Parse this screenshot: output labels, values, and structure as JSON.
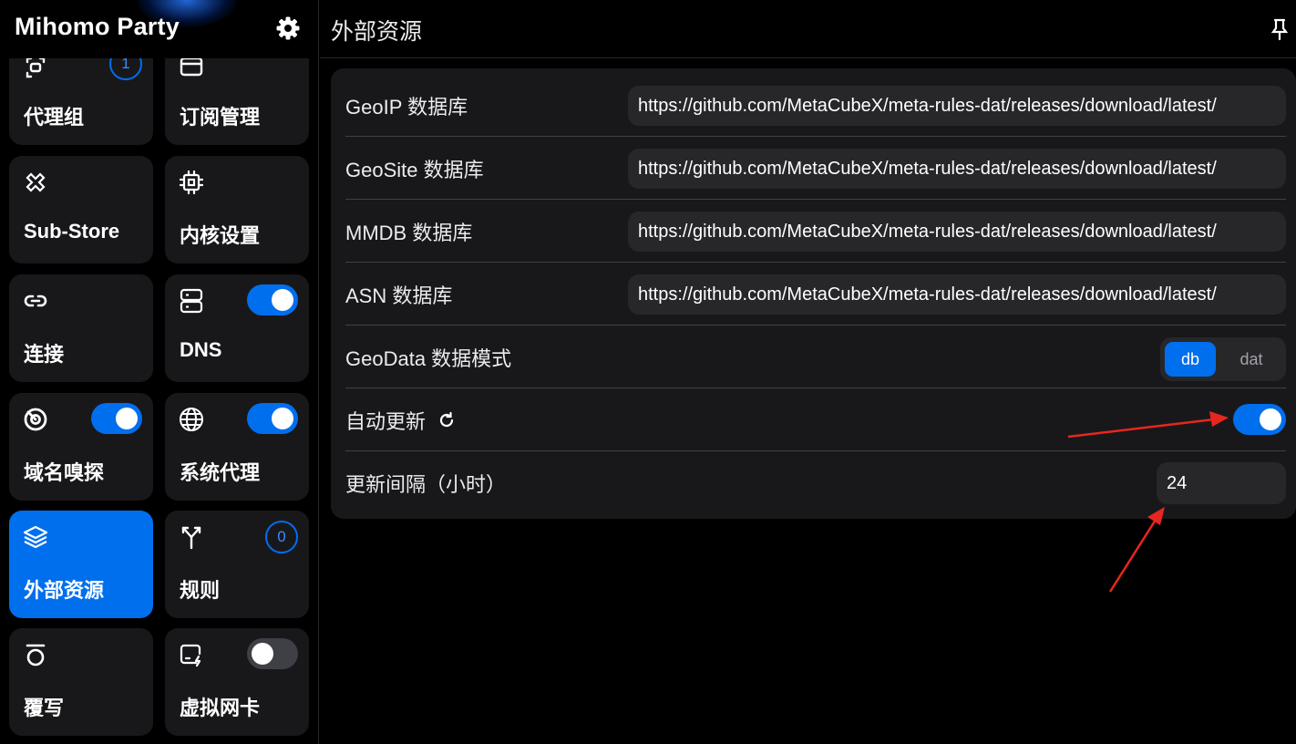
{
  "app": {
    "title": "Mihomo Party"
  },
  "sidebar": {
    "cards": [
      {
        "label": "代理组",
        "badge": "1"
      },
      {
        "label": "订阅管理"
      },
      {
        "label": "Sub-Store"
      },
      {
        "label": "内核设置"
      },
      {
        "label": "连接"
      },
      {
        "label": "DNS",
        "toggle": "on"
      },
      {
        "label": "域名嗅探",
        "toggle": "on"
      },
      {
        "label": "系统代理",
        "toggle": "on"
      },
      {
        "label": "外部资源",
        "active": true
      },
      {
        "label": "规则",
        "badge": "0"
      },
      {
        "label": "覆写"
      },
      {
        "label": "虚拟网卡",
        "toggle": "off"
      }
    ]
  },
  "main": {
    "title": "外部资源",
    "settings": [
      {
        "label": "GeoIP 数据库",
        "value": "https://github.com/MetaCubeX/meta-rules-dat/releases/download/latest/"
      },
      {
        "label": "GeoSite 数据库",
        "value": "https://github.com/MetaCubeX/meta-rules-dat/releases/download/latest/"
      },
      {
        "label": "MMDB 数据库",
        "value": "https://github.com/MetaCubeX/meta-rules-dat/releases/download/latest/"
      },
      {
        "label": "ASN 数据库",
        "value": "https://github.com/MetaCubeX/meta-rules-dat/releases/download/latest/"
      },
      {
        "label": "GeoData 数据模式",
        "options": [
          "db",
          "dat"
        ],
        "selected": "db"
      },
      {
        "label": "自动更新",
        "toggle": "on"
      },
      {
        "label": "更新间隔（小时）",
        "value": "24"
      }
    ]
  },
  "colors": {
    "accent": "#006fee",
    "card_bg": "#18181b",
    "input_bg": "#27272a",
    "annotation": "#e8261f"
  }
}
